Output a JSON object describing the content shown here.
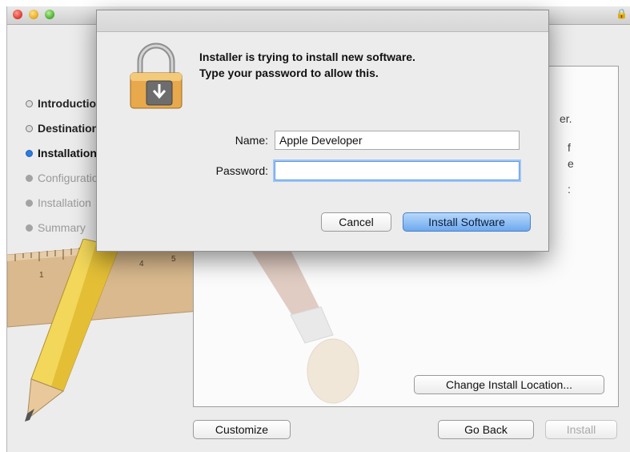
{
  "window": {
    "steps": [
      {
        "label": "Introduction",
        "state": "done"
      },
      {
        "label": "Destination Select",
        "state": "done"
      },
      {
        "label": "Installation Type",
        "state": "current"
      },
      {
        "label": "Configuration",
        "state": "pending"
      },
      {
        "label": "Installation",
        "state": "pending"
      },
      {
        "label": "Summary",
        "state": "pending"
      }
    ],
    "panel_fragments": [
      "er.",
      "f",
      "e",
      ":"
    ],
    "buttons": {
      "change_location": "Change Install Location...",
      "customize": "Customize",
      "go_back": "Go Back",
      "install": "Install"
    }
  },
  "auth_dialog": {
    "message_line1": "Installer is trying to install new software.",
    "message_line2": "Type your password to allow this.",
    "name_label": "Name:",
    "name_value": "Apple Developer",
    "password_label": "Password:",
    "password_value": "",
    "cancel_label": "Cancel",
    "install_label": "Install Software"
  },
  "colors": {
    "accent": "#2c7ce0",
    "primary_button": "#6ea9ef"
  },
  "icons": [
    "lock-icon",
    "pencil-icon",
    "ruler-icon",
    "brush-icon"
  ]
}
